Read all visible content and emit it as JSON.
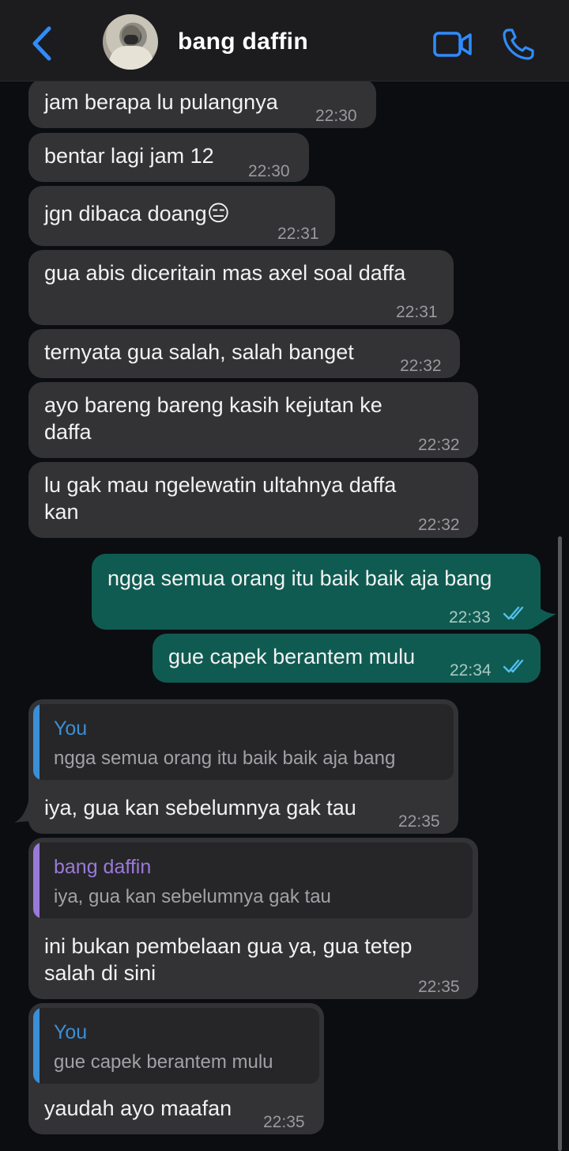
{
  "header": {
    "contact_name": "bang daffin",
    "back_icon": "chevron-left-icon",
    "video_icon": "video-camera-icon",
    "call_icon": "phone-icon",
    "accent_color": "#2f8cff"
  },
  "messages": [
    {
      "direction": "incoming",
      "text": "jam berapa lu pulangnya",
      "time": "22:30"
    },
    {
      "direction": "incoming",
      "text": "bentar lagi jam 12",
      "time": "22:30"
    },
    {
      "direction": "incoming",
      "text": "jgn dibaca doang",
      "emoji": "😑",
      "time": "22:31"
    },
    {
      "direction": "incoming",
      "text": "gua abis diceritain mas axel soal daffa",
      "time": "22:31"
    },
    {
      "direction": "incoming",
      "text": "ternyata gua salah, salah banget",
      "time": "22:32"
    },
    {
      "direction": "incoming",
      "lines": [
        "ayo bareng bareng kasih kejutan ke",
        "daffa"
      ],
      "time": "22:32"
    },
    {
      "direction": "incoming",
      "lines": [
        "lu gak mau ngelewatin ultahnya daffa",
        "kan"
      ],
      "time": "22:32"
    },
    {
      "direction": "outgoing",
      "text": "ngga semua orang itu baik baik aja bang",
      "time": "22:33",
      "status": "read"
    },
    {
      "direction": "outgoing",
      "text": "gue capek berantem mulu",
      "time": "22:34",
      "status": "read"
    },
    {
      "direction": "incoming",
      "reply_to": {
        "author": "You",
        "text": "ngga semua orang itu baik baik aja bang"
      },
      "text": "iya, gua kan sebelumnya gak tau",
      "time": "22:35"
    },
    {
      "direction": "incoming",
      "reply_to": {
        "author": "bang daffin",
        "text": "iya, gua kan sebelumnya gak tau"
      },
      "lines": [
        "ini bukan pembelaan gua ya, gua tetep",
        "salah di sini"
      ],
      "time": "22:35"
    },
    {
      "direction": "incoming",
      "reply_to": {
        "author": "You",
        "text": "gue capek berantem mulu"
      },
      "text": "yaudah ayo maafan",
      "time": "22:35"
    }
  ],
  "colors": {
    "incoming_bubble": "#333336",
    "outgoing_bubble": "#0f5b52",
    "read_ticks": "#53bdeb",
    "reply_you": "#3b8fd6",
    "reply_contact": "#9a7ad8"
  }
}
